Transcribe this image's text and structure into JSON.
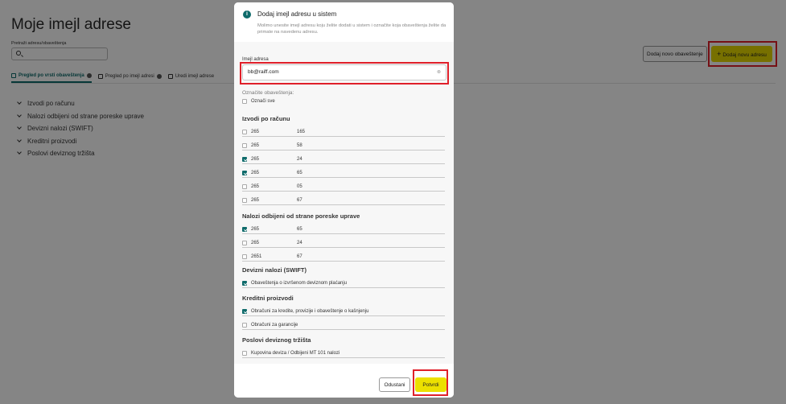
{
  "page": {
    "title": "Moje imejl adrese",
    "search_label": "Pretraži adresu/obaveštenja",
    "search_placeholder": "",
    "tabs": [
      {
        "label": "Pregled po vrsti obaveštenja",
        "active": true
      },
      {
        "label": "Pregled po imejl adresi",
        "active": false
      },
      {
        "label": "Uredi imejl adrese",
        "active": false
      }
    ],
    "categories": [
      "Izvodi po računu",
      "Nalozi odbijeni od strane poreske uprave",
      "Devizni nalozi (SWIFT)",
      "Kreditni proizvodi",
      "Poslovi deviznog tržišta"
    ],
    "add_notification_button": "Dodaj novo obaveštenje",
    "add_address_button": "Dodaj novu adresu",
    "add_address_icon": "plus-icon"
  },
  "modal": {
    "title": "Dodaj imejl adresu u sistem",
    "description": "Molimo unesite imejl adresu koju želite dodati u sistem i označite koja obaveštenja želite da primate na navedenu adresu.",
    "email_label": "Imejl adresa",
    "email_value": "bb@raiff.com",
    "notifications_label": "Označite obaveštenja:",
    "select_all_label": "Označi sve",
    "sections": [
      {
        "title": "Izvodi po računu",
        "rows": [
          {
            "col1": "265",
            "col2": "165",
            "checked": false
          },
          {
            "col1": "265",
            "col2": "58",
            "checked": false
          },
          {
            "col1": "265",
            "col2": "24",
            "checked": true
          },
          {
            "col1": "265",
            "col2": "65",
            "checked": true
          },
          {
            "col1": "265",
            "col2": "05",
            "checked": false
          },
          {
            "col1": "265",
            "col2": "67",
            "checked": false
          }
        ]
      },
      {
        "title": "Nalozi odbijeni od strane poreske uprave",
        "rows": [
          {
            "col1": "265",
            "col2": "65",
            "checked": true
          },
          {
            "col1": "265",
            "col2": "24",
            "checked": false
          },
          {
            "col1": "2651",
            "col2": "67",
            "checked": false
          }
        ]
      },
      {
        "title": "Devizni nalozi (SWIFT)",
        "rows": [
          {
            "text": "Obaveštenja o izvršenom deviznom plaćanju",
            "checked": true
          }
        ]
      },
      {
        "title": "Kreditni proizvodi",
        "rows": [
          {
            "text": "Obračuni za kredite, provizije i obaveštenje o kašnjenju",
            "checked": true
          },
          {
            "text": "Obračuni za garancije",
            "checked": false
          }
        ]
      },
      {
        "title": "Poslovi deviznog tržišta",
        "rows": [
          {
            "text": "Kupovina deviza / Odbijeni MT 101 nalozi",
            "checked": false
          }
        ]
      }
    ],
    "cancel_button": "Odustani",
    "confirm_button": "Potvrdi"
  },
  "colors": {
    "accent_teal": "#0f6b6b",
    "brand_yellow": "#ece000",
    "highlight_red": "#e0202a"
  }
}
